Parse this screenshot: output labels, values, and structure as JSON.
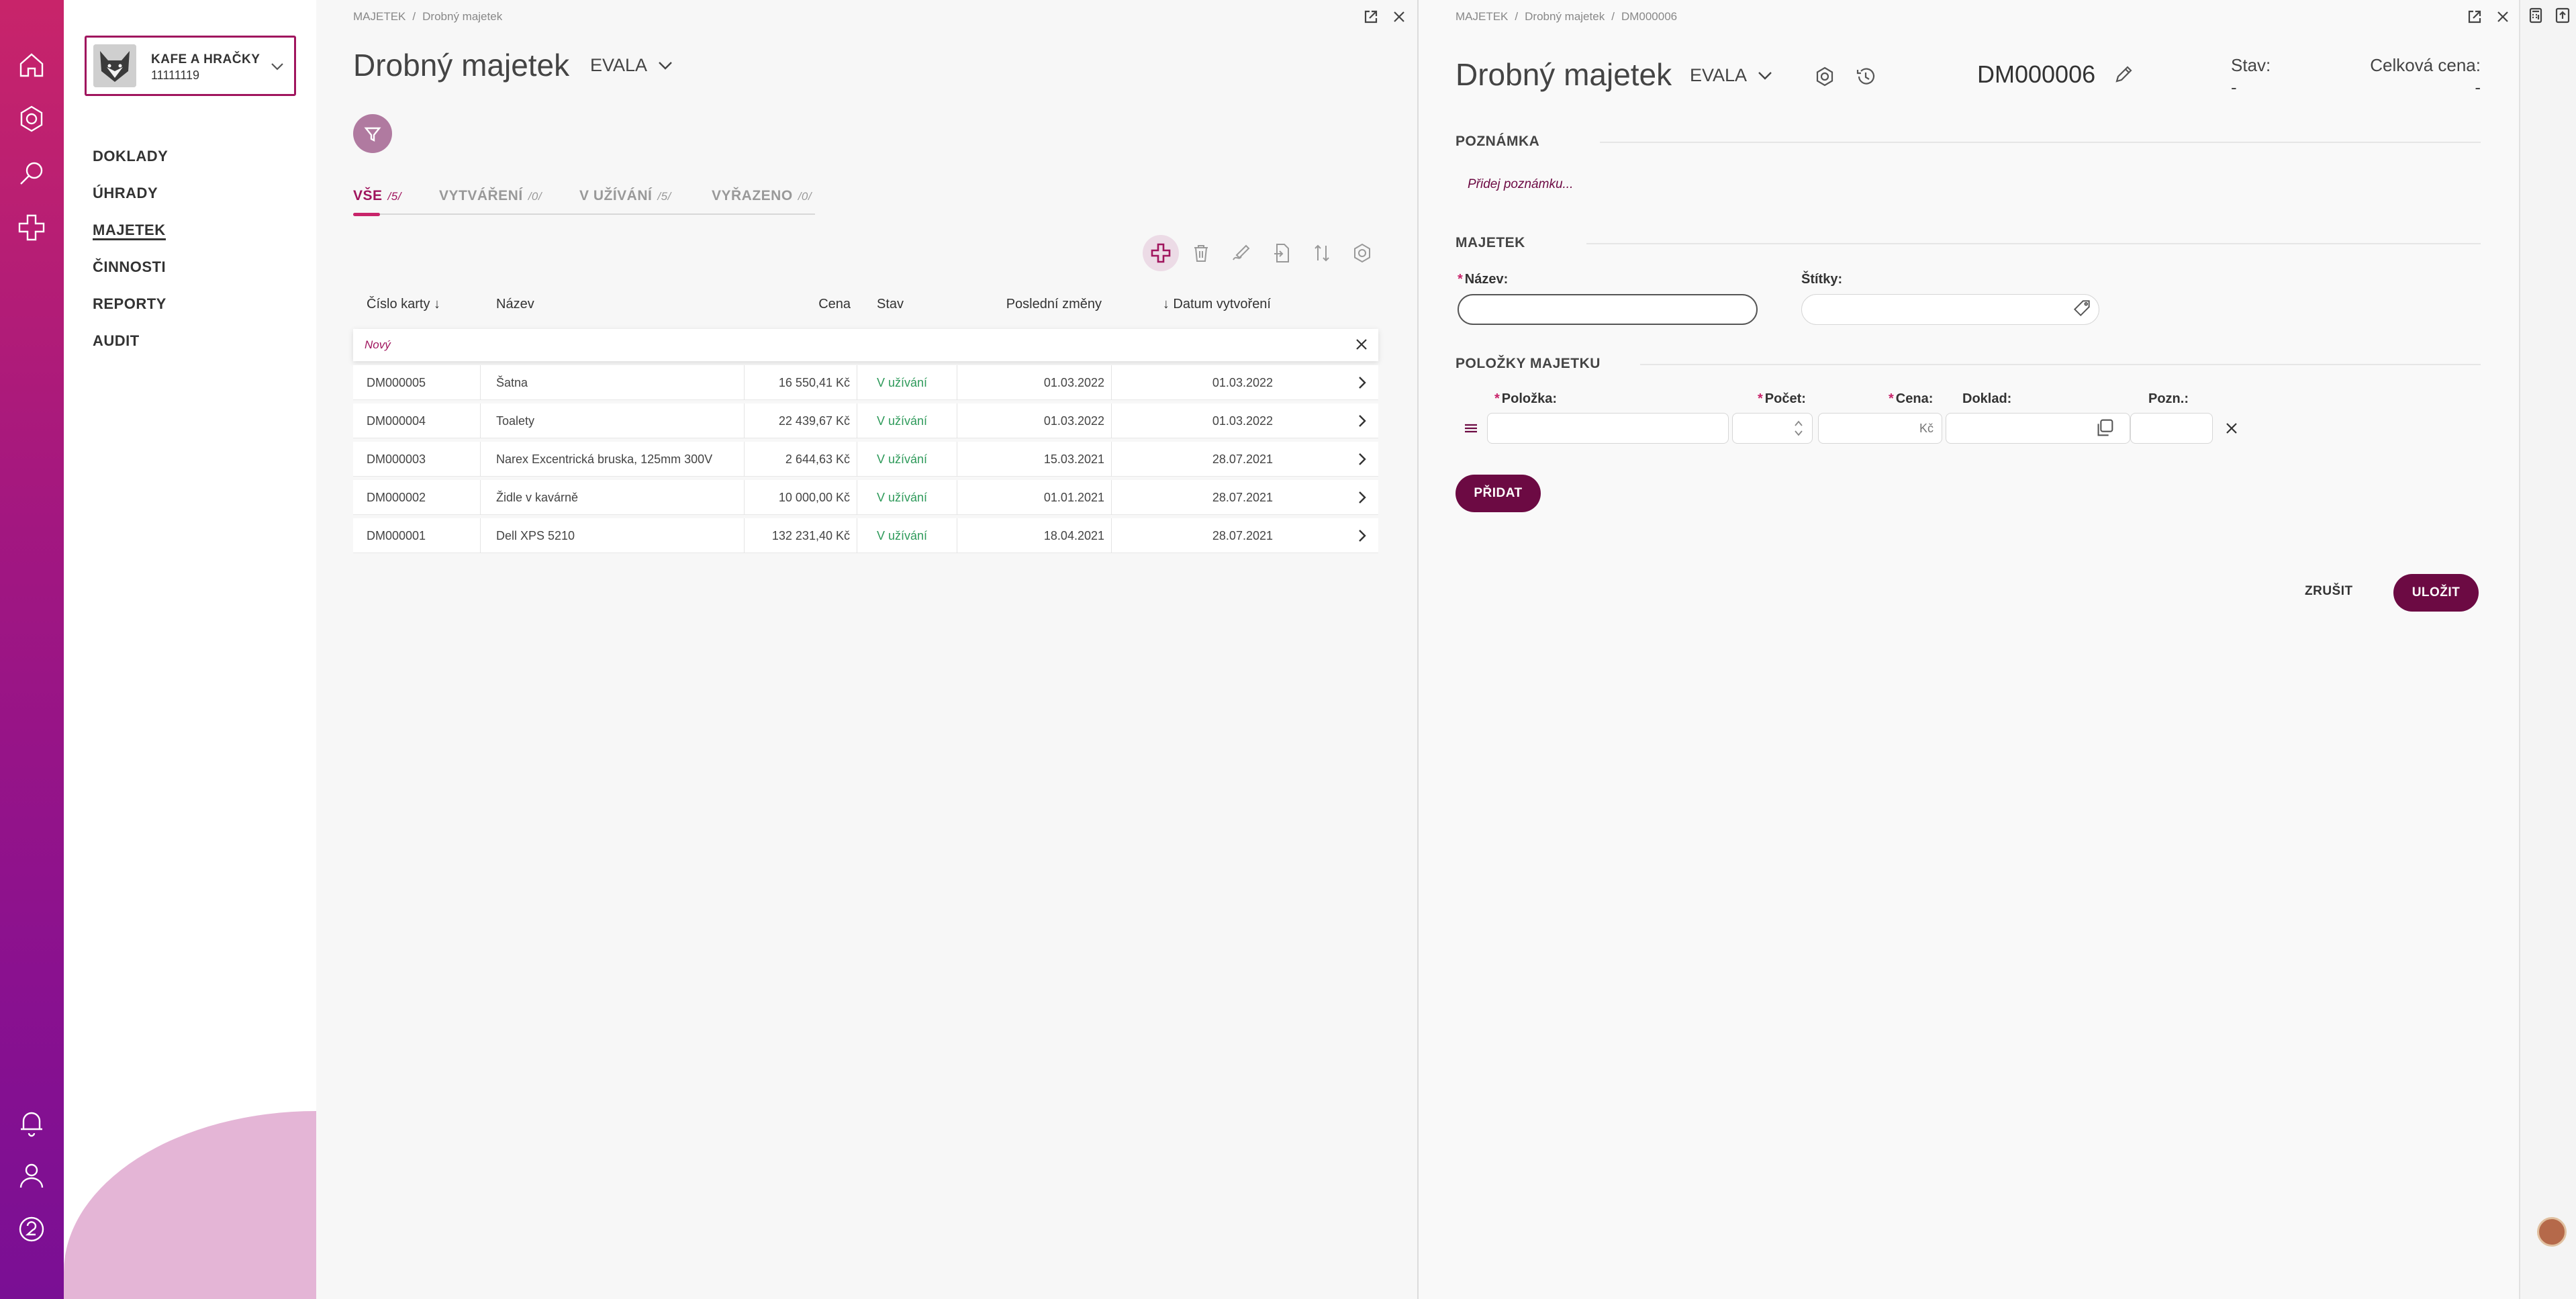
{
  "company": {
    "name": "KAFE A HRAČKY",
    "id": "11111119"
  },
  "nav": [
    "DOKLADY",
    "ÚHRADY",
    "MAJETEK",
    "ČINNOSTI",
    "REPORTY",
    "AUDIT"
  ],
  "left": {
    "breadcrumb": [
      "MAJETEK",
      "Drobný majetek"
    ],
    "title": "Drobný majetek",
    "org": "EVALA",
    "tabs": [
      {
        "label": "VŠE",
        "count": "/5/"
      },
      {
        "label": "VYTVÁŘENÍ",
        "count": "/0/"
      },
      {
        "label": "V UŽÍVÁNÍ",
        "count": "/5/"
      },
      {
        "label": "VYŘAZENO",
        "count": "/0/"
      }
    ],
    "columns": {
      "card": "Číslo karty ↓",
      "name": "Název",
      "price": "Cena",
      "state": "Stav",
      "changed": "Poslední změny",
      "created": "↓ Datum vytvoření"
    },
    "new_row": "Nový",
    "rows": [
      {
        "card": "DM000005",
        "name": "Šatna",
        "price": "16 550,41 Kč",
        "state": "V užívání",
        "changed": "01.03.2022",
        "created": "01.03.2022"
      },
      {
        "card": "DM000004",
        "name": "Toalety",
        "price": "22 439,67 Kč",
        "state": "V užívání",
        "changed": "01.03.2022",
        "created": "01.03.2022"
      },
      {
        "card": "DM000003",
        "name": "Narex Excentrická bruska, 125mm 300V",
        "price": "2 644,63 Kč",
        "state": "V užívání",
        "changed": "15.03.2021",
        "created": "28.07.2021"
      },
      {
        "card": "DM000002",
        "name": "Židle v kavárně",
        "price": "10 000,00 Kč",
        "state": "V užívání",
        "changed": "01.01.2021",
        "created": "28.07.2021"
      },
      {
        "card": "DM000001",
        "name": "Dell XPS 5210",
        "price": "132 231,40 Kč",
        "state": "V užívání",
        "changed": "18.04.2021",
        "created": "28.07.2021"
      }
    ]
  },
  "right": {
    "breadcrumb": [
      "MAJETEK",
      "Drobný majetek",
      "DM000006"
    ],
    "title": "Drobný majetek",
    "org": "EVALA",
    "doc_id": "DM000006",
    "stav_label": "Stav:",
    "stav_value": "-",
    "total_label": "Celková cena:",
    "total_value": "-",
    "note_section": "POZNÁMKA",
    "note_placeholder": "Přidej poznámku...",
    "asset_section": "MAJETEK",
    "name_label": "Název:",
    "tags_label": "Štítky:",
    "items_section": "POLOŽKY MAJETKU",
    "item_cols": {
      "item": "Položka:",
      "count": "Počet:",
      "price": "Cena:",
      "doc": "Doklad:",
      "note": "Pozn.:"
    },
    "price_unit": "Kč",
    "add_button": "PŘIDAT",
    "cancel_button": "ZRUŠIT",
    "save_button": "ULOŽIT"
  },
  "colors": {
    "accent": "#a0155e",
    "dark_accent": "#6c0a43",
    "status_green": "#2e9a5a"
  }
}
